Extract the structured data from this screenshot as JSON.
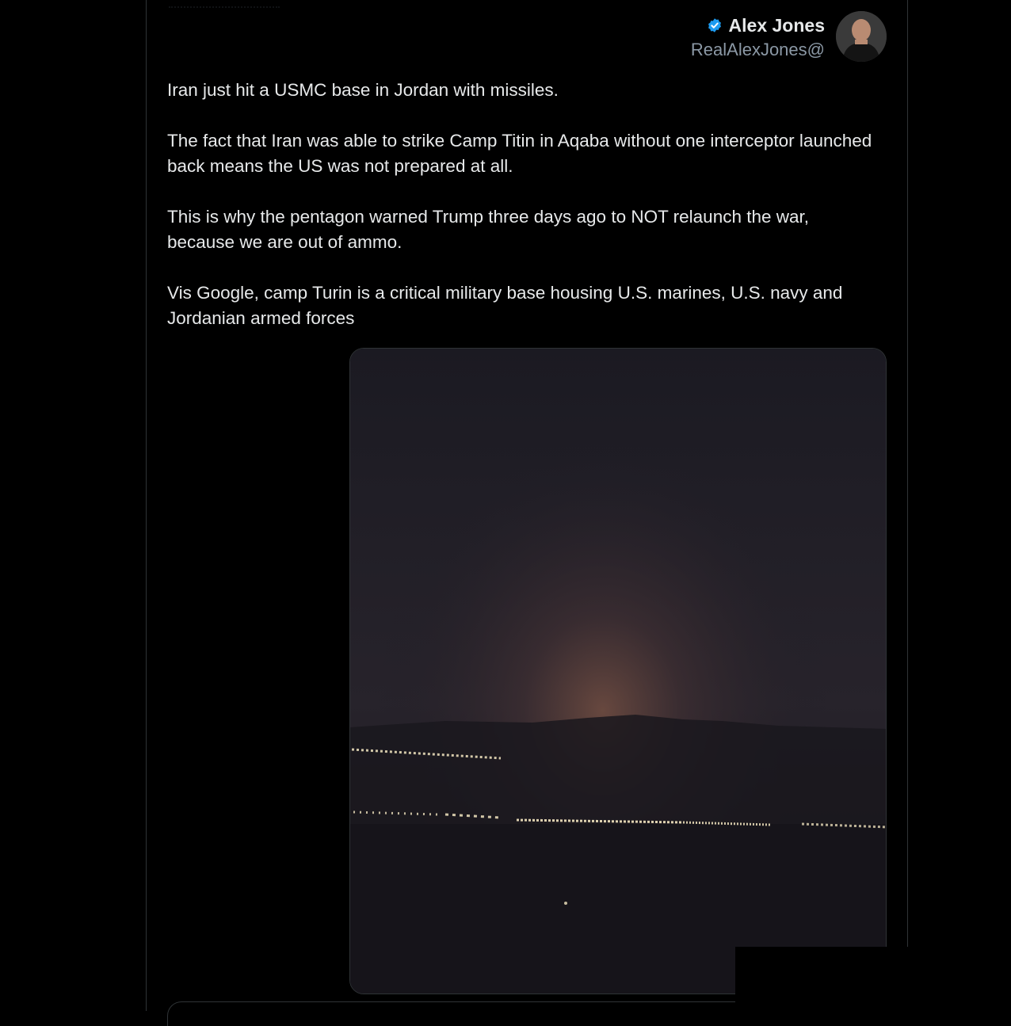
{
  "post": {
    "author": {
      "display_name": "Alex Jones",
      "handle": "RealAlexJones@",
      "verified_icon": "verified-badge-icon",
      "avatar_icon": "avatar"
    },
    "paragraphs": [
      "Iran just hit a USMC base in Jordan with missiles.",
      "The fact that Iran was able to strike Camp Titin in Aqaba without one interceptor launched back means the US was not prepared at all.",
      "This is why the pentagon warned Trump three days ago to NOT relaunch the war, because we are out of ammo.",
      "Vis Google, camp Turin is a critical military base housing U.S. marines, U.S. navy and Jordanian armed forces"
    ],
    "media": {
      "kind": "video-still",
      "sky_color": "#24212a",
      "glow_color": "#6b4a40",
      "light_color": "#f3e6c0"
    }
  },
  "colors": {
    "background": "#000000",
    "text": "#e7e9ea",
    "secondary_text": "#8b98a5",
    "verified": "#1d9bf0",
    "border": "#2f3336"
  }
}
